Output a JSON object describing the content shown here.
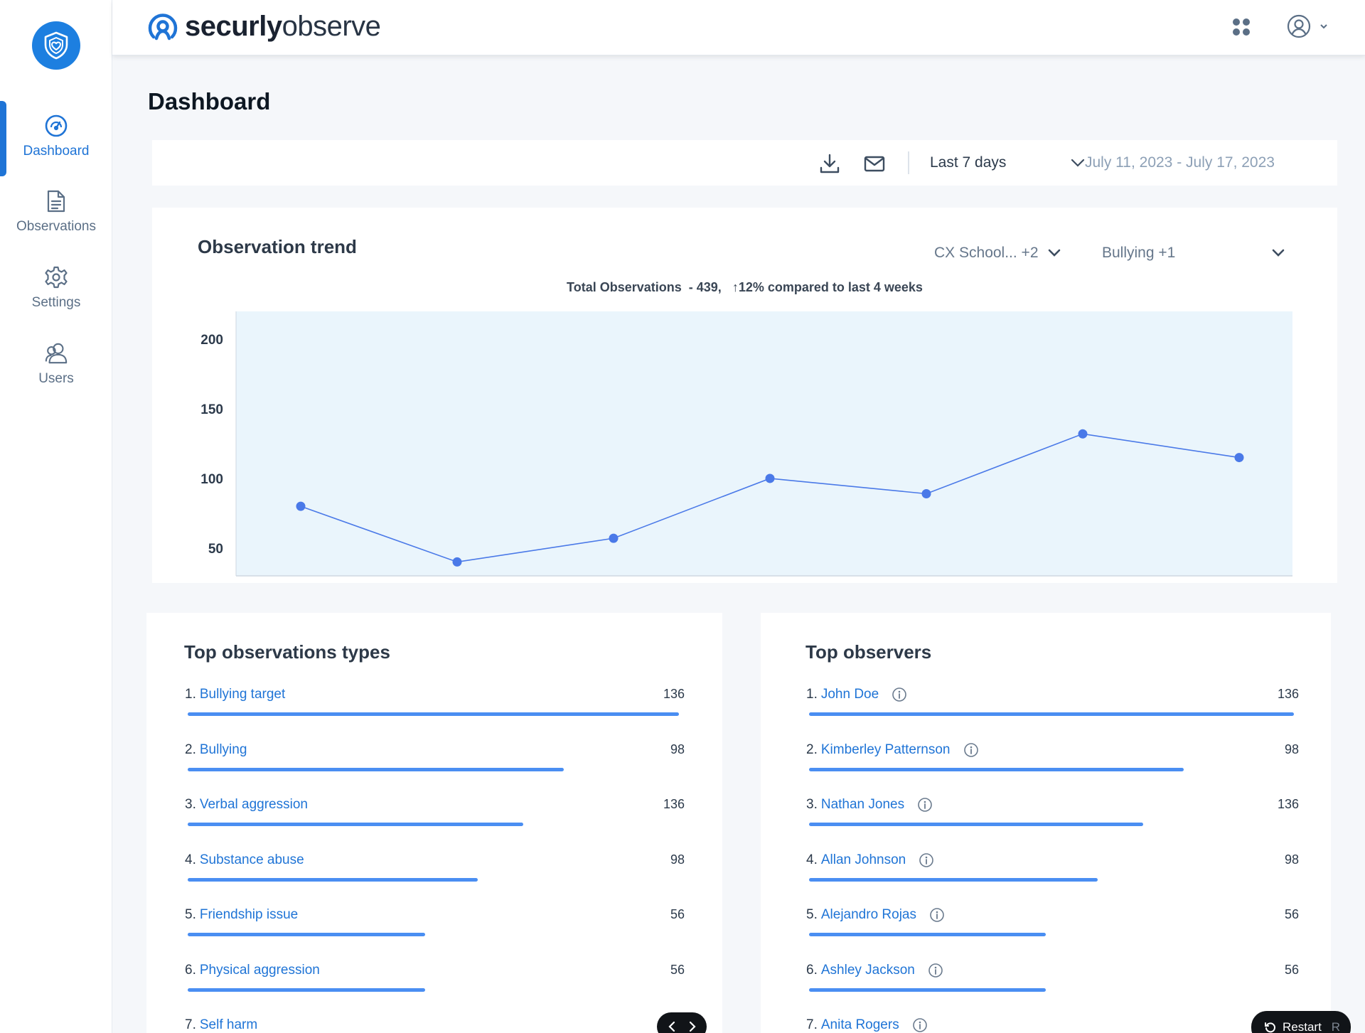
{
  "app": {
    "logo_bold": "securly",
    "logo_light": "observe"
  },
  "sidebar": {
    "items": [
      {
        "label": "Dashboard",
        "icon": "dashboard-gauge-icon",
        "active": true
      },
      {
        "label": "Observations",
        "icon": "document-icon",
        "active": false
      },
      {
        "label": "Settings",
        "icon": "gear-icon",
        "active": false
      },
      {
        "label": "Users",
        "icon": "users-icon",
        "active": false
      }
    ]
  },
  "header": {
    "page_title": "Dashboard"
  },
  "toolbar": {
    "download_icon": "download-icon",
    "email_icon": "email-icon",
    "range_label": "Last 7 days",
    "date_range": "July 11, 2023 - July 17, 2023"
  },
  "trend": {
    "title": "Observation trend",
    "school_filter": "CX School... +2",
    "type_filter": "Bullying +1",
    "total_label": "Total Observations",
    "total_value": "- 439,",
    "change_text": "12% compared to last 4 weeks"
  },
  "chart_data": {
    "type": "line",
    "title": "",
    "xlabel": "",
    "ylabel": "",
    "ylim": [
      30,
      220
    ],
    "y_ticks": [
      50,
      100,
      150,
      200
    ],
    "x": [
      1,
      2,
      3,
      4,
      5,
      6,
      7
    ],
    "series": [
      {
        "values": [
          80,
          40,
          57,
          100,
          89,
          132,
          115
        ]
      }
    ],
    "grid": false,
    "colors": {
      "line": "#4a79e8",
      "plot_bg": "#eaf5fc"
    }
  },
  "top_types": {
    "title": "Top observations types",
    "items": [
      {
        "rank": "1.",
        "name": "Bullying target",
        "value": "136",
        "fraction": 1.0
      },
      {
        "rank": "2.",
        "name": "Bullying",
        "value": "98",
        "fraction": 0.765
      },
      {
        "rank": "3.",
        "name": "Verbal aggression",
        "value": "136",
        "fraction": 0.683
      },
      {
        "rank": "4.",
        "name": "Substance abuse",
        "value": "98",
        "fraction": 0.59
      },
      {
        "rank": "5.",
        "name": "Friendship issue",
        "value": "56",
        "fraction": 0.484
      },
      {
        "rank": "6.",
        "name": "Physical aggression",
        "value": "56",
        "fraction": 0.484
      },
      {
        "rank": "7.",
        "name": "Self harm",
        "value": "",
        "fraction": 0
      }
    ]
  },
  "top_observers": {
    "title": "Top observers",
    "items": [
      {
        "rank": "1.",
        "name": "John Doe",
        "value": "136",
        "fraction": 1.0
      },
      {
        "rank": "2.",
        "name": "Kimberley Patternson",
        "value": "98",
        "fraction": 0.772
      },
      {
        "rank": "3.",
        "name": "Nathan Jones",
        "value": "136",
        "fraction": 0.689
      },
      {
        "rank": "4.",
        "name": "Allan Johnson",
        "value": "98",
        "fraction": 0.596
      },
      {
        "rank": "5.",
        "name": "Alejandro Rojas",
        "value": "56",
        "fraction": 0.488
      },
      {
        "rank": "6.",
        "name": "Ashley Jackson",
        "value": "56",
        "fraction": 0.488
      },
      {
        "rank": "7.",
        "name": "Anita Rogers",
        "value": "",
        "fraction": 0
      }
    ]
  },
  "overlay": {
    "restart_label": "Restart",
    "restart_key": "R"
  },
  "colors": {
    "accent": "#1f74d6",
    "bar": "#4a8ef2",
    "brand_badge": "#1d7fe0"
  }
}
